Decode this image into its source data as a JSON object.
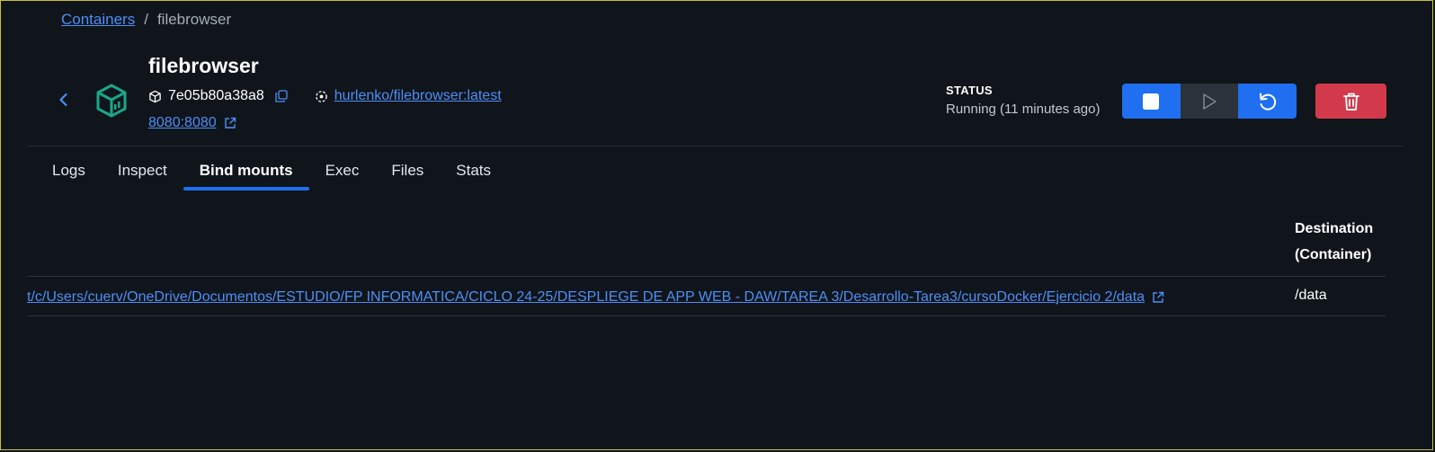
{
  "breadcrumb": {
    "parent": "Containers",
    "separator": "/",
    "current": "filebrowser"
  },
  "container": {
    "name": "filebrowser",
    "id": "7e05b80a38a8",
    "image": "hurlenko/filebrowser:latest",
    "ports": "8080:8080"
  },
  "status": {
    "label": "STATUS",
    "value": "Running (11 minutes ago)"
  },
  "tabs": [
    {
      "label": "Logs"
    },
    {
      "label": "Inspect"
    },
    {
      "label": "Bind mounts",
      "active": true
    },
    {
      "label": "Exec"
    },
    {
      "label": "Files"
    },
    {
      "label": "Stats"
    }
  ],
  "table": {
    "dest_header_line1": "Destination",
    "dest_header_line2": "(Container)",
    "rows": [
      {
        "source": "t/c/Users/cuerv/OneDrive/Documentos/ESTUDIO/FP INFORMATICA/CICLO 24-25/DESPLIEGE DE APP WEB - DAW/TAREA 3/Desarrollo-Tarea3/cursoDocker/Ejercicio 2/data",
        "destination": "/data"
      }
    ]
  },
  "colors": {
    "accent": "#1f6ff0",
    "danger": "#d23a4b",
    "link": "#4f8ef7",
    "cube": "#1aa68a",
    "background": "#0f151b"
  },
  "icons": {
    "back": "chevron-left-icon",
    "container": "container-cube-icon",
    "id": "box-icon",
    "copy": "copy-icon",
    "image": "image-icon",
    "external": "external-link-icon",
    "stop": "stop-icon",
    "start": "play-icon",
    "restart": "restart-icon",
    "delete": "trash-icon"
  }
}
